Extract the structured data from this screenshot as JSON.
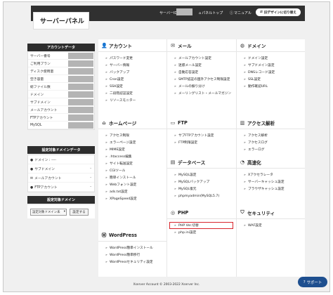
{
  "header": {
    "logo": "サーバーパネル",
    "server_id_label": "サーバーID",
    "links": [
      {
        "icon": "home-icon",
        "glyph": "⌂",
        "label": "パネルトップ"
      },
      {
        "icon": "question-icon",
        "glyph": "?",
        "label": "マニュアル"
      }
    ],
    "switch_button": "旧デザインに切り替え"
  },
  "sidebar": {
    "account_title": "アカウントデータ",
    "account_rows": [
      "サーバー番号",
      "ご利用プラン",
      "ディスク使用量",
      "空き容量",
      "総ファイル数",
      "ドメイン",
      "サブドメイン",
      "メールアカウント",
      "FTPアカウント",
      "MySQL"
    ],
    "domain_data_title": "設定対象ドメインデータ",
    "domain_rows": [
      {
        "label": "ドメイン",
        "value": "----"
      },
      {
        "label": "サブドメイン",
        "value": "-"
      },
      {
        "label": "メールアカウント",
        "value": "-"
      },
      {
        "label": "FTPアカウント",
        "value": "-"
      }
    ],
    "target_title": "設定対象ドメイン",
    "select_value": "設定対象ドメイン未",
    "set_button": "設定する"
  },
  "categories": {
    "account": {
      "title": "アカウント",
      "items": [
        "パスワード変更",
        "サーバー情報",
        "バックアップ",
        "Cron設定",
        "SSH設定",
        "二段階認証設定",
        "リソースモニター"
      ]
    },
    "mail": {
      "title": "メール",
      "items": [
        "メールアカウント設定",
        "迷惑メール設定",
        "自動応答設定",
        "SMTP認証の国外アクセス制限設定",
        "メールの振り分け",
        "メーリングリスト・メールマガジン"
      ]
    },
    "domain": {
      "title": "ドメイン",
      "items": [
        "ドメイン設定",
        "サブドメイン設定",
        "DNSレコード設定",
        "SSL設定",
        "動作確認URL"
      ]
    },
    "homepage": {
      "title": "ホームページ",
      "items": [
        "アクセス制限",
        "エラーページ設定",
        "MIME設定",
        ".htaccess編集",
        "サイト転送設定",
        "CGIツール",
        "簡単インストール",
        "Webフォント設定",
        "ads.txt設定",
        "XPageSpeed設定"
      ]
    },
    "ftp": {
      "title": "FTP",
      "items": [
        "サブFTPアカウント設定",
        "FTP制限設定"
      ]
    },
    "analytics": {
      "title": "アクセス解析",
      "items": [
        "アクセス解析",
        "アクセスログ",
        "エラーログ"
      ]
    },
    "database": {
      "title": "データベース",
      "items": [
        "MySQL設定",
        "MySQLバックアップ",
        "MySQL復元",
        "phpmyadmin(MySQL5.7)"
      ]
    },
    "speed": {
      "title": "高速化",
      "items": [
        "Xアクセラレータ",
        "サーバーキャッシュ設定",
        "ブラウザキャッシュ設定"
      ]
    },
    "php": {
      "title": "PHP",
      "items": [
        "PHP Ver.切替",
        "php.ini設定"
      ]
    },
    "security": {
      "title": "セキュリティ",
      "items": [
        "WAF設定"
      ]
    },
    "wordpress": {
      "title": "WordPress",
      "items": [
        "WordPress簡単インストール",
        "WordPress簡単移行",
        "WordPressセキュリティ設定"
      ]
    }
  },
  "footer": "Xserver Account © 2003-2022 Xserver Inc.",
  "support_button": "サポート",
  "colors": {
    "header_bg": "#303030",
    "highlight": "#d8232a",
    "support_bg": "#1e4f8f"
  }
}
